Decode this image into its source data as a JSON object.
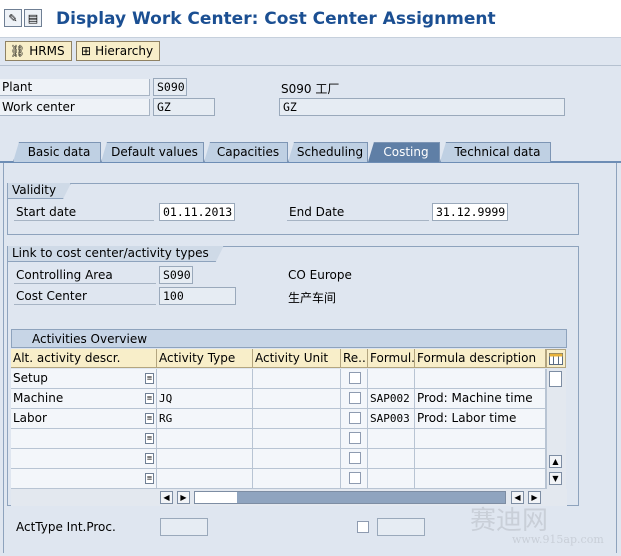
{
  "window": {
    "title": "Display Work Center: Cost Center Assignment"
  },
  "toolbar": {
    "hrms_label": "HRMS",
    "hierarchy_label": "Hierarchy"
  },
  "header": {
    "plant_label": "Plant",
    "plant_value": "S090",
    "plant_desc": "S090 工厂",
    "workcenter_label": "Work center",
    "workcenter_value": "GZ",
    "workcenter_desc": "GZ"
  },
  "tabs": [
    {
      "label": "Basic data",
      "active": false
    },
    {
      "label": "Default values",
      "active": false
    },
    {
      "label": "Capacities",
      "active": false
    },
    {
      "label": "Scheduling",
      "active": false
    },
    {
      "label": "Costing",
      "active": true
    },
    {
      "label": "Technical data",
      "active": false
    }
  ],
  "validity": {
    "title": "Validity",
    "start_label": "Start date",
    "start_value": "01.11.2013",
    "end_label": "End Date",
    "end_value": "31.12.9999"
  },
  "link": {
    "title": "Link to cost center/activity types",
    "controlling_area_label": "Controlling Area",
    "controlling_area_value": "S090",
    "controlling_area_desc": "CO Europe",
    "cost_center_label": "Cost Center",
    "cost_center_value": "100",
    "cost_center_desc": "生产车间"
  },
  "activities": {
    "title": "Activities Overview",
    "columns": [
      "Alt. activity descr.",
      "Activity Type",
      "Activity Unit",
      "Re...",
      "Formul...",
      "Formula description"
    ],
    "rows": [
      {
        "alt": "Setup",
        "type": "",
        "unit": "",
        "formula": "",
        "desc": ""
      },
      {
        "alt": "Machine",
        "type": "JQ",
        "unit": "",
        "formula": "SAP002",
        "desc": "Prod: Machine time"
      },
      {
        "alt": "Labor",
        "type": "RG",
        "unit": "",
        "formula": "SAP003",
        "desc": "Prod: Labor time"
      },
      {
        "alt": "",
        "type": "",
        "unit": "",
        "formula": "",
        "desc": ""
      },
      {
        "alt": "",
        "type": "",
        "unit": "",
        "formula": "",
        "desc": ""
      },
      {
        "alt": "",
        "type": "",
        "unit": "",
        "formula": "",
        "desc": ""
      }
    ]
  },
  "acttype_label": "ActType Int.Proc.",
  "watermark": {
    "text": "赛迪网",
    "url": "www.915ap.com"
  },
  "colors": {
    "title": "#1b4f92",
    "active_tab": "#5f7fa6",
    "toolbar_button": "#f8eec9"
  }
}
